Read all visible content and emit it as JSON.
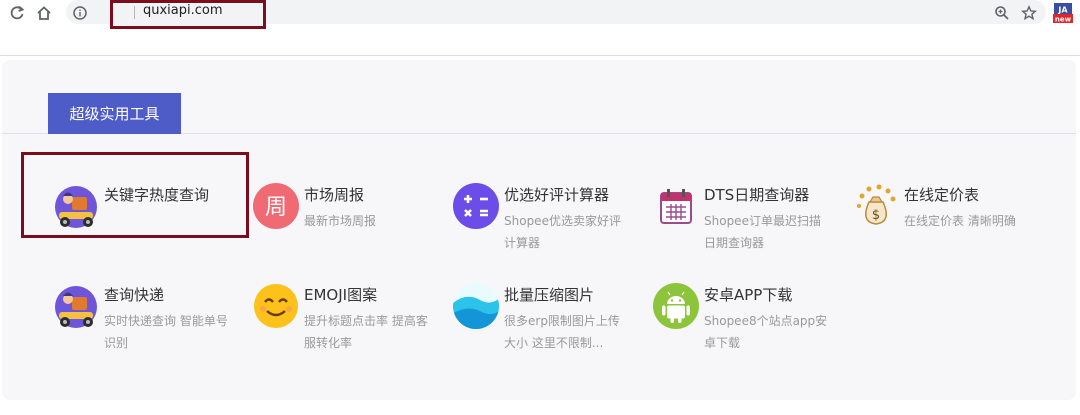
{
  "browser": {
    "url": "quxiapi.com",
    "icons": [
      "reload-icon",
      "home-icon",
      "info-icon",
      "zoom-icon",
      "star-icon",
      "extension-new-icon"
    ],
    "ext_badge_top": "JA",
    "ext_badge_bottom": "new"
  },
  "tab": {
    "label": "超级实用工具"
  },
  "tools": [
    {
      "title": "关键字热度查询",
      "desc": "",
      "icon": "delivery-scooter-icon"
    },
    {
      "title": "市场周报",
      "desc": "最新市场周报",
      "icon": "zhou-badge-icon",
      "icon_char": "周",
      "color": "#f06a73"
    },
    {
      "title": "优选好评计算器",
      "desc": "Shopee优选卖家好评计算器",
      "icon": "calculator-icon",
      "color": "#6d4de8"
    },
    {
      "title": "DTS日期查询器",
      "desc": "Shopee订单最迟扫描日期查询器",
      "icon": "calendar-icon"
    },
    {
      "title": "在线定价表",
      "desc": "在线定价表 清晰明确",
      "icon": "money-bag-icon"
    },
    {
      "title": "查询快递",
      "desc": "实时快递查询 智能单号识别",
      "icon": "delivery-scooter-icon"
    },
    {
      "title": "EMOJI图案",
      "desc": "提升标题点击率 提高客服转化率",
      "icon": "smiley-icon"
    },
    {
      "title": "批量压缩图片",
      "desc": "很多erp限制图片上传大小 这里不限制...",
      "icon": "wave-image-icon"
    },
    {
      "title": "安卓APP下载",
      "desc": "Shopee8个站点app安卓下载",
      "icon": "android-icon",
      "color": "#8cc43c"
    }
  ]
}
